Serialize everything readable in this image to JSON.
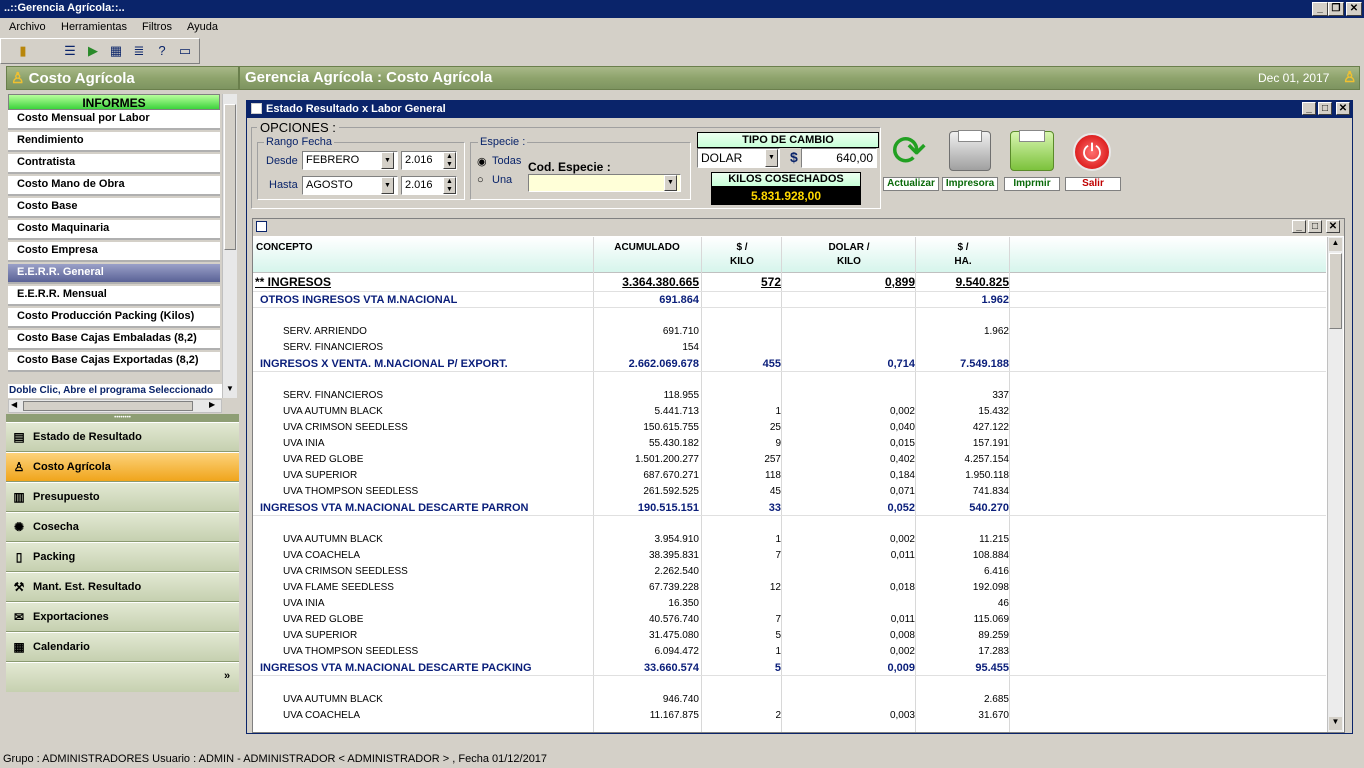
{
  "window": {
    "title": "..::Gerencia Agrícola::.."
  },
  "menu": [
    "Archivo",
    "Herramientas",
    "Filtros",
    "Ayuda"
  ],
  "left": {
    "title": "Costo Agrícola",
    "informes_title": "INFORMES",
    "reports": [
      "Costo Mensual por Labor",
      "Rendimiento",
      "Contratista",
      "Costo Mano de Obra",
      "Costo Base",
      "Costo Maquinaria",
      "Costo Empresa",
      "E.E.R.R. General",
      "E.E.R.R. Mensual",
      "Costo Producción Packing (Kilos)",
      "Costo Base Cajas Embaladas (8,2)",
      "Costo Base Cajas Exportadas (8,2)"
    ],
    "hint": "Doble Clic, Abre el programa Seleccionado",
    "nav": [
      "Estado de Resultado",
      "Costo Agrícola",
      "Presupuesto",
      "Cosecha",
      "Packing",
      "Mant. Est. Resultado",
      "Exportaciones",
      "Calendario"
    ]
  },
  "main": {
    "title": "Gerencia Agrícola : Costo Agrícola",
    "date": "Dec 01, 2017"
  },
  "inner": {
    "title": "Estado Resultado x Labor General",
    "opciones": "OPCIONES :",
    "rango": "Rango Fecha",
    "desde": "Desde",
    "hasta": "Hasta",
    "desde_mes": "FEBRERO",
    "desde_anio": "2.016",
    "hasta_mes": "AGOSTO",
    "hasta_anio": "2.016",
    "especie": "Especie :",
    "todas": "Todas",
    "una": "Una",
    "cod_especie": "Cod. Especie :",
    "tipo_cambio": "TIPO DE CAMBIO",
    "moneda": "DOLAR",
    "signo": "$",
    "cambio": "640,00",
    "kilos_label": "KILOS COSECHADOS",
    "kilos": "5.831.928,00",
    "buttons": [
      "Actualizar",
      "Impresora",
      "Imprmir",
      "Salir"
    ]
  },
  "grid": {
    "headers": [
      "CONCEPTO",
      "ACUMULADO",
      "$ /\nKILO",
      "DOLAR /\nKILO",
      "$ /\nHA."
    ],
    "rows": [
      {
        "t": "ing",
        "c": "** INGRESOS",
        "a": "3.364.380.665",
        "b": "572",
        "d": "0,899",
        "e": "9.540.825"
      },
      {
        "t": "sec",
        "c": "OTROS INGRESOS VTA M.NACIONAL",
        "a": "691.864",
        "b": "",
        "d": "",
        "e": "1.962"
      },
      {
        "t": "blank"
      },
      {
        "t": "item",
        "c": "SERV. ARRIENDO",
        "a": "691.710",
        "b": "",
        "d": "",
        "e": "1.962"
      },
      {
        "t": "item",
        "c": "SERV. FINANCIEROS",
        "a": "154",
        "b": "",
        "d": "",
        "e": ""
      },
      {
        "t": "sec",
        "c": "INGRESOS X VENTA. M.NACIONAL P/ EXPORT.",
        "a": "2.662.069.678",
        "b": "455",
        "d": "0,714",
        "e": "7.549.188"
      },
      {
        "t": "blank"
      },
      {
        "t": "item",
        "c": "SERV. FINANCIEROS",
        "a": "118.955",
        "b": "",
        "d": "",
        "e": "337"
      },
      {
        "t": "item",
        "c": "UVA AUTUMN BLACK",
        "a": "5.441.713",
        "b": "1",
        "d": "0,002",
        "e": "15.432"
      },
      {
        "t": "item",
        "c": "UVA CRIMSON SEEDLESS",
        "a": "150.615.755",
        "b": "25",
        "d": "0,040",
        "e": "427.122"
      },
      {
        "t": "item",
        "c": "UVA INIA",
        "a": "55.430.182",
        "b": "9",
        "d": "0,015",
        "e": "157.191"
      },
      {
        "t": "item",
        "c": "UVA RED GLOBE",
        "a": "1.501.200.277",
        "b": "257",
        "d": "0,402",
        "e": "4.257.154"
      },
      {
        "t": "item",
        "c": "UVA SUPERIOR",
        "a": "687.670.271",
        "b": "118",
        "d": "0,184",
        "e": "1.950.118"
      },
      {
        "t": "item",
        "c": "UVA THOMPSON SEEDLESS",
        "a": "261.592.525",
        "b": "45",
        "d": "0,071",
        "e": "741.834"
      },
      {
        "t": "sec",
        "c": "INGRESOS VTA M.NACIONAL DESCARTE PARRON",
        "a": "190.515.151",
        "b": "33",
        "d": "0,052",
        "e": "540.270"
      },
      {
        "t": "blank"
      },
      {
        "t": "item",
        "c": "UVA AUTUMN BLACK",
        "a": "3.954.910",
        "b": "1",
        "d": "0,002",
        "e": "11.215"
      },
      {
        "t": "item",
        "c": "UVA COACHELA",
        "a": "38.395.831",
        "b": "7",
        "d": "0,011",
        "e": "108.884"
      },
      {
        "t": "item",
        "c": "UVA CRIMSON SEEDLESS",
        "a": "2.262.540",
        "b": "",
        "d": "",
        "e": "6.416"
      },
      {
        "t": "item",
        "c": "UVA FLAME SEEDLESS",
        "a": "67.739.228",
        "b": "12",
        "d": "0,018",
        "e": "192.098"
      },
      {
        "t": "item",
        "c": "UVA INIA",
        "a": "16.350",
        "b": "",
        "d": "",
        "e": "46"
      },
      {
        "t": "item",
        "c": "UVA RED GLOBE",
        "a": "40.576.740",
        "b": "7",
        "d": "0,011",
        "e": "115.069"
      },
      {
        "t": "item",
        "c": "UVA SUPERIOR",
        "a": "31.475.080",
        "b": "5",
        "d": "0,008",
        "e": "89.259"
      },
      {
        "t": "item",
        "c": "UVA THOMPSON SEEDLESS",
        "a": "6.094.472",
        "b": "1",
        "d": "0,002",
        "e": "17.283"
      },
      {
        "t": "sec",
        "c": "INGRESOS VTA M.NACIONAL DESCARTE PACKING",
        "a": "33.660.574",
        "b": "5",
        "d": "0,009",
        "e": "95.455"
      },
      {
        "t": "blank"
      },
      {
        "t": "item",
        "c": "UVA AUTUMN BLACK",
        "a": "946.740",
        "b": "",
        "d": "",
        "e": "2.685"
      },
      {
        "t": "item",
        "c": "UVA COACHELA",
        "a": "11.167.875",
        "b": "2",
        "d": "0,003",
        "e": "31.670"
      }
    ]
  },
  "status": "Grupo : ADMINISTRADORES Usuario : ADMIN - ADMINISTRADOR  < ADMINISTRADOR > , Fecha 01/12/2017"
}
